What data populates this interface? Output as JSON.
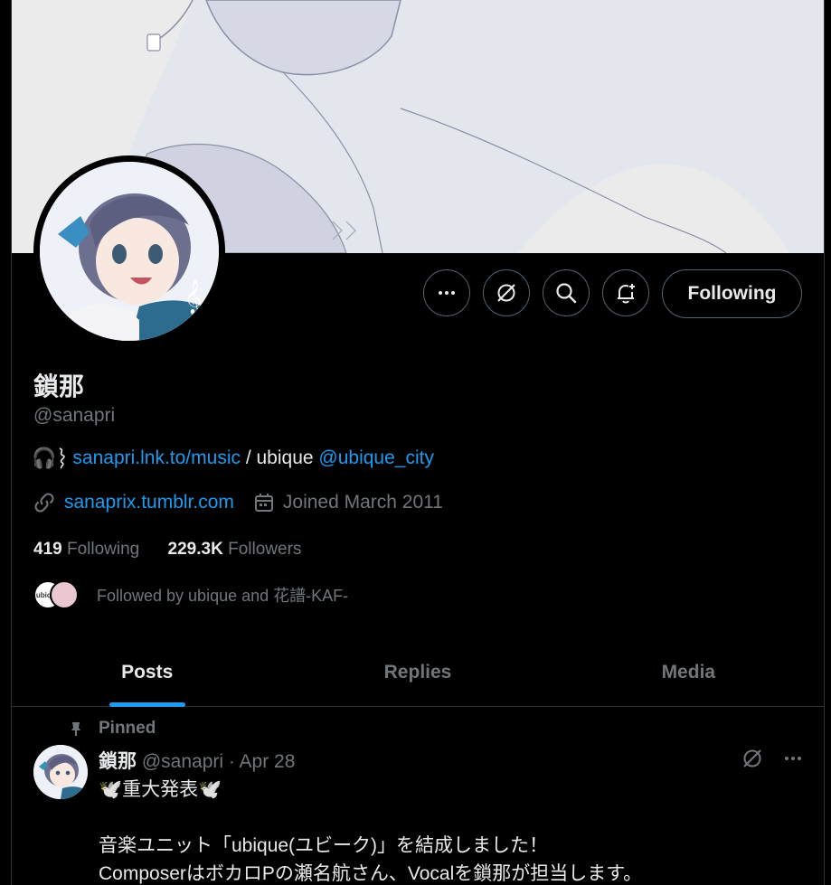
{
  "profile": {
    "name": "鎖那",
    "handle": "@sanapri",
    "bio": {
      "emoji": "🎧",
      "link1": "sanapri.lnk.to/music",
      "middle": " / ubique ",
      "mention": "@ubique_city"
    },
    "website": "sanaprix.tumblr.com",
    "joined": "Joined March 2011",
    "following_count": "419",
    "following_label": "Following",
    "followers_count": "229.3K",
    "followers_label": "Followers",
    "followed_by": "Followed by ubique and 花譜-KAF-",
    "mini_avatar_text": "ubique"
  },
  "actions": {
    "follow_label": "Following",
    "more_icon": "more-icon",
    "grok_icon": "grok-icon",
    "search_icon": "search-icon",
    "notify_icon": "notification-bell-plus-icon"
  },
  "tabs": [
    {
      "label": "Posts",
      "active": true
    },
    {
      "label": "Replies",
      "active": false
    },
    {
      "label": "Media",
      "active": false
    }
  ],
  "post": {
    "pinned_label": "Pinned",
    "author": "鎖那",
    "handle_date": " @sanapri · Apr 28",
    "line1": "🕊️重大発表🕊️",
    "line2": "",
    "line3": "音楽ユニット「ubique(ユビーク)」を結成しました！",
    "line4": "ComposerはボカロPの瀬名航さん、Vocalを鎖那が担当します。"
  },
  "colors": {
    "accent": "#1d9bf0",
    "background": "#000000",
    "muted": "#71767b",
    "text": "#e7e9ea",
    "border": "#2f3336"
  }
}
